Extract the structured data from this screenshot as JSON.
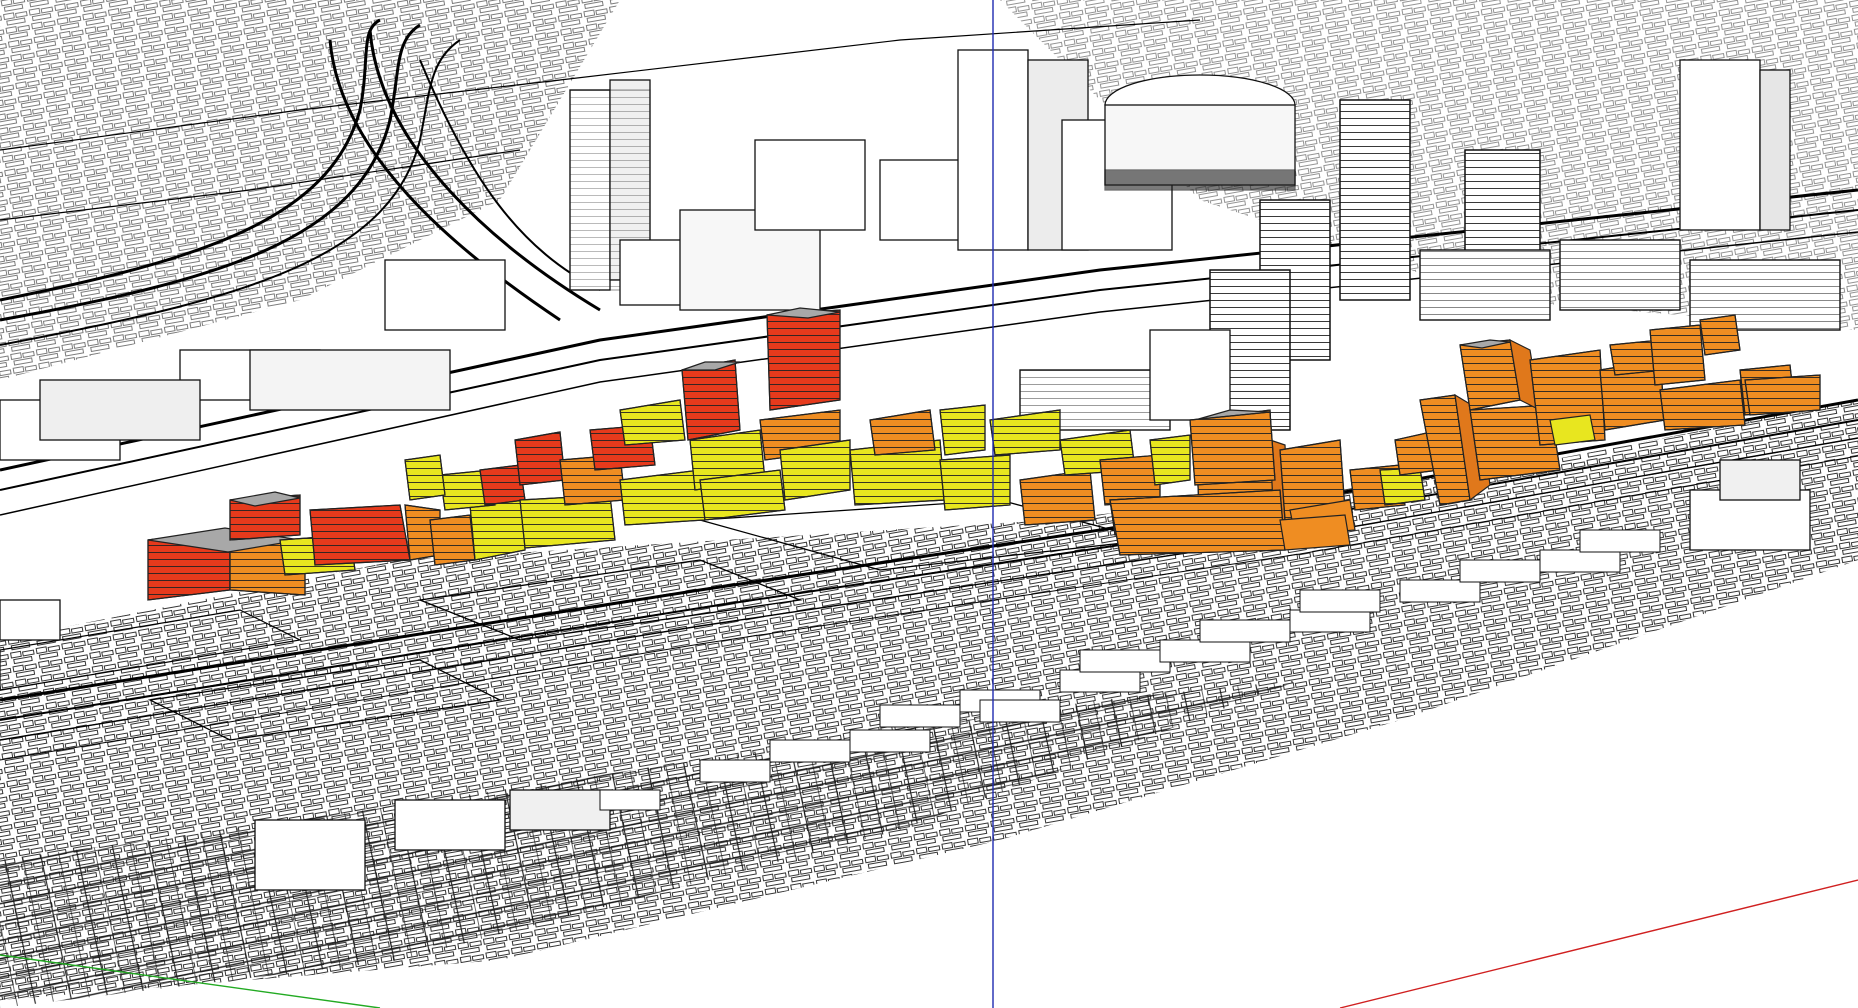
{
  "viewport": {
    "background": "#ffffff",
    "axis_colors": {
      "blue_axis": "#1f2bb0",
      "red_axis": "#d02020",
      "green_axis": "#22aa22"
    },
    "edge_color": "#000000",
    "face_colors": {
      "red": "#e63a1c",
      "orange": "#ef8d22",
      "yellow": "#e8e61f",
      "white": "#ffffff",
      "roof_gray": "#a8a8a8",
      "wall_shade": "#d9d9d9"
    }
  },
  "model": {
    "tower_layers": [
      "red",
      "orange",
      "yellow"
    ],
    "context": "white"
  }
}
